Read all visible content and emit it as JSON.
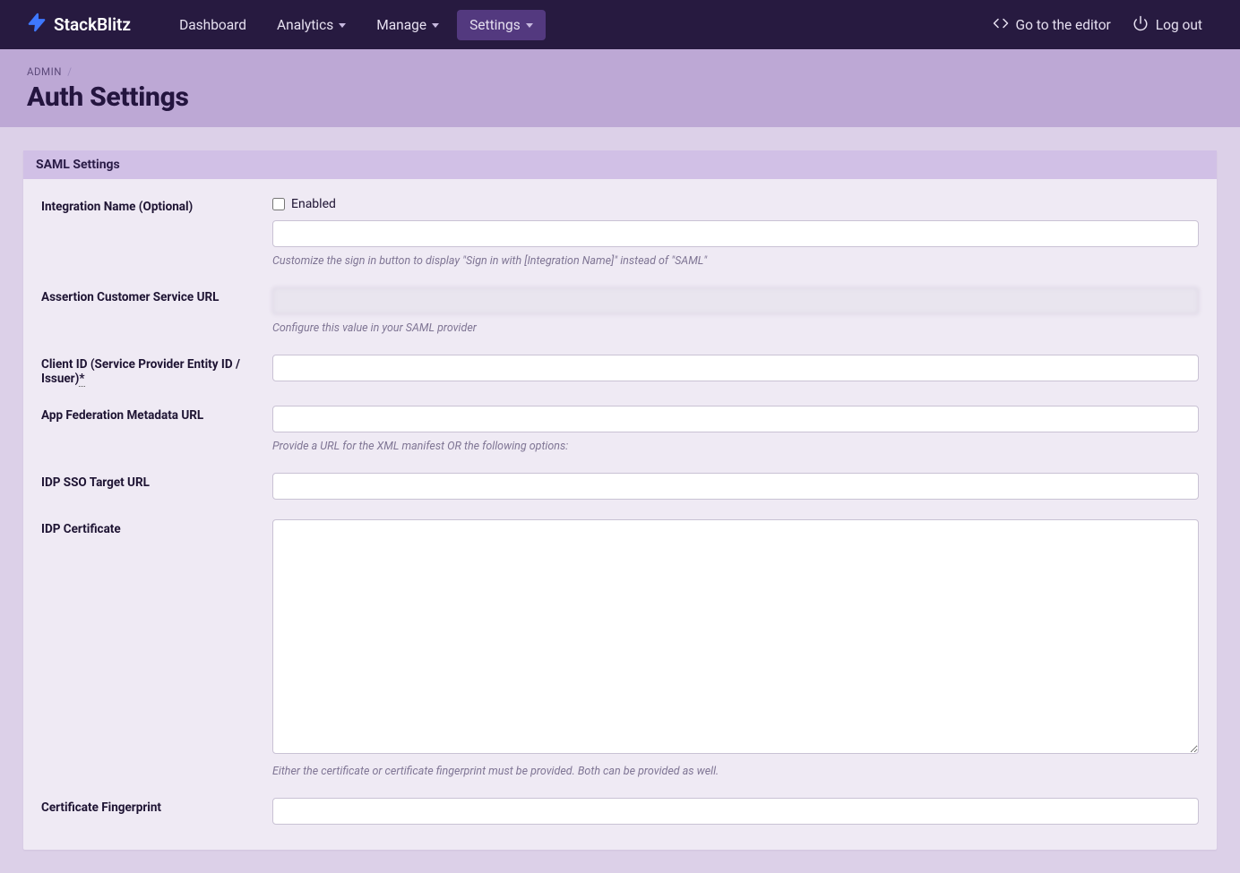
{
  "brand": "StackBlitz",
  "nav": {
    "dashboard": "Dashboard",
    "analytics": "Analytics",
    "manage": "Manage",
    "settings": "Settings",
    "editor": "Go to the editor",
    "logout": "Log out"
  },
  "breadcrumb": {
    "admin": "ADMIN"
  },
  "pageTitle": "Auth Settings",
  "panel": {
    "heading": "SAML Settings"
  },
  "fields": {
    "enabled_label": "Enabled",
    "integration_name": {
      "label": "Integration Name (Optional)",
      "hint": "Customize the sign in button to display \"Sign in with [Integration Name]\" instead of \"SAML\""
    },
    "acs_url": {
      "label": "Assertion Customer Service URL",
      "value": "",
      "hint": "Configure this value in your SAML provider"
    },
    "client_id": {
      "label": "Client ID (Service Provider Entity ID / Issuer)",
      "asterisk": "*"
    },
    "metadata_url": {
      "label": "App Federation Metadata URL",
      "hint": "Provide a URL for the XML manifest OR the following options:"
    },
    "sso_url": {
      "label": "IDP SSO Target URL"
    },
    "idp_cert": {
      "label": "IDP Certificate",
      "hint": "Either the certificate or certificate fingerprint must be provided. Both can be provided as well."
    },
    "fingerprint": {
      "label": "Certificate Fingerprint"
    }
  }
}
